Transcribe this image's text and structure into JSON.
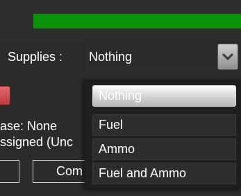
{
  "progress": {
    "fill_color": "#079207",
    "value": 1.0
  },
  "supplies": {
    "label": "Supplies :",
    "selected": "Nothing",
    "dropdown_icon": "chevron-down-icon",
    "options": [
      "Nothing",
      "Fuel",
      "Ammo",
      "Fuel and Ammo"
    ],
    "highlighted": "Nothing"
  },
  "left_panel": {
    "base_text": "ase: None",
    "assigned_text": "ssigned (Unc",
    "command_button_label": "Com"
  }
}
